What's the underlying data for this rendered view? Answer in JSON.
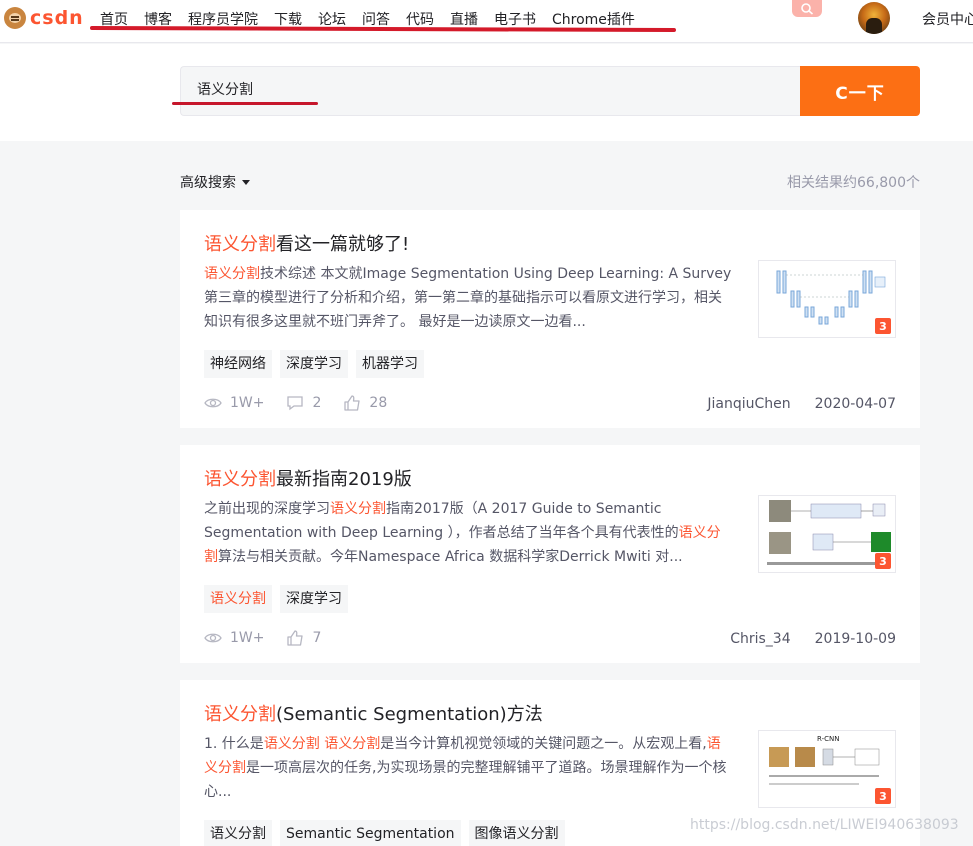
{
  "logo": {
    "text": "CSDN"
  },
  "nav": {
    "items": [
      "首页",
      "博客",
      "程序员学院",
      "下载",
      "论坛",
      "问答",
      "代码",
      "直播",
      "电子书",
      "Chrome插件"
    ],
    "vip_label": "会员中心"
  },
  "search": {
    "query": "语义分割",
    "button_label": "C一下"
  },
  "filter": {
    "advanced_label": "高级搜索",
    "result_count": "相关结果约66,800个"
  },
  "colors": {
    "accent": "#fc5531",
    "button": "#fc6f14",
    "annotation_red": "#d41a2a"
  },
  "results": [
    {
      "title_hl": "语义分割",
      "title_rest": "看这一篇就够了!",
      "desc_parts": [
        {
          "t": "语义分割",
          "hl": true
        },
        {
          "t": "技术综述 本文就Image Segmentation Using Deep Learning: A Survey 第三章的模型进行了分析和介绍，第一第二章的基础指示可以看原文进行学习，相关知识有很多这里就不班门弄斧了。 最好是一边读原文一边看...",
          "hl": false
        }
      ],
      "tags": [
        {
          "label": "神经网络",
          "hl": false
        },
        {
          "label": "深度学习",
          "hl": false
        },
        {
          "label": "机器学习",
          "hl": false
        }
      ],
      "views": "1W+",
      "comments": "2",
      "likes": "28",
      "author": "JianqiuChen",
      "date": "2020-04-07",
      "thumb_badge": "3"
    },
    {
      "title_hl": "语义分割",
      "title_rest": "最新指南2019版",
      "desc_parts": [
        {
          "t": "之前出现的深度学习",
          "hl": false
        },
        {
          "t": "语义分割",
          "hl": true
        },
        {
          "t": "指南2017版（A 2017 Guide to Semantic Segmentation with Deep Learning ），作者总结了当年各个具有代表性的",
          "hl": false
        },
        {
          "t": "语义分割",
          "hl": true
        },
        {
          "t": "算法与相关贡献。今年Namespace Africa 数据科学家Derrick Mwiti 对...",
          "hl": false
        }
      ],
      "tags": [
        {
          "label": "语义分割",
          "hl": true
        },
        {
          "label": "深度学习",
          "hl": false
        }
      ],
      "views": "1W+",
      "comments": "",
      "likes": "7",
      "author": "Chris_34",
      "date": "2019-10-09",
      "thumb_badge": "3"
    },
    {
      "title_hl": "语义分割",
      "title_rest": "(Semantic Segmentation)方法",
      "desc_parts": [
        {
          "t": "1. 什么是",
          "hl": false
        },
        {
          "t": "语义分割 语义分割",
          "hl": true
        },
        {
          "t": "是当今计算机视觉领域的关键问题之一。从宏观上看,",
          "hl": false
        },
        {
          "t": "语义分割",
          "hl": true
        },
        {
          "t": "是一项高层次的任务,为实现场景的完整理解铺平了道路。场景理解作为一个核心...",
          "hl": false
        }
      ],
      "tags": [
        {
          "label": "语义分割",
          "hl": false
        },
        {
          "label": "Semantic Segmentation",
          "hl": false
        },
        {
          "label": "图像语义分割",
          "hl": false
        }
      ],
      "thumb_title": "R-CNN",
      "thumb_badge": "3"
    }
  ],
  "watermark": "https://blog.csdn.net/LIWEI940638093"
}
